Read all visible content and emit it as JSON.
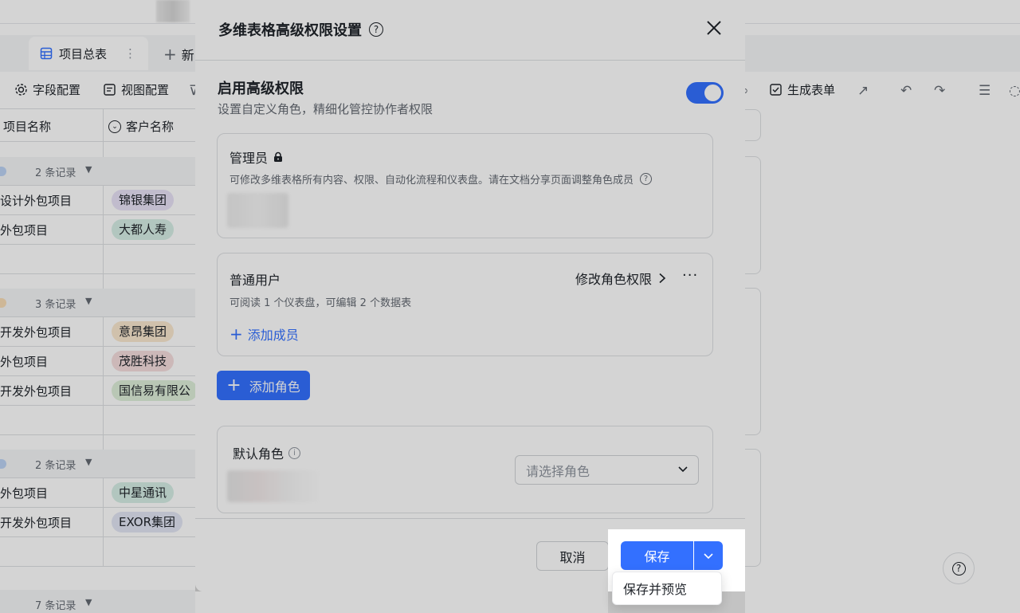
{
  "app": {
    "tab_label": "项目总表",
    "new_tab_label": "新",
    "toolbar": {
      "field_config": "字段配置",
      "view_config": "视图配置",
      "generate_form": "生成表单"
    },
    "grid": {
      "col1_header": "项目名称",
      "col2_header": "客户名称",
      "groups": [
        {
          "count": "2 条记录",
          "rows": [
            {
              "name": "设计外包项目",
              "client": "锦银集团",
              "tag_color": "#e8e2f7"
            },
            {
              "name": "外包项目",
              "client": "大都人寿",
              "tag_color": "#d7efe6"
            }
          ]
        },
        {
          "count": "3 条记录",
          "rows": [
            {
              "name": "开发外包项目",
              "client": "意昂集团",
              "tag_color": "#fbe8cf"
            },
            {
              "name": "外包项目",
              "client": "茂胜科技",
              "tag_color": "#f6dede"
            },
            {
              "name": "开发外包项目",
              "client": "国信易有限公",
              "tag_color": "#dff0da"
            }
          ]
        },
        {
          "count": "2 条记录",
          "rows": [
            {
              "name": "外包项目",
              "client": "中星通讯",
              "tag_color": "#d7efe6"
            },
            {
              "name": "开发外包项目",
              "client": "EXOR集团",
              "tag_color": "#e3e6f5"
            }
          ]
        },
        {
          "count": "7 条记录",
          "rows": []
        }
      ]
    }
  },
  "modal": {
    "title": "多维表格高级权限设置",
    "enable_title": "启用高级权限",
    "enable_subtitle": "设置自定义角色，精细化管控协作者权限",
    "toggle_on": true,
    "admin_card": {
      "title": "管理员",
      "desc": "可修改多维表格所有内容、权限、自动化流程和仪表盘。请在文档分享页面调整角色成员"
    },
    "user_card": {
      "title": "普通用户",
      "edit_perm": "修改角色权限",
      "desc": "可阅读 1 个仪表盘，可编辑 2 个数据表",
      "add_member": "添加成员"
    },
    "add_role": "添加角色",
    "default_role": {
      "title": "默认角色",
      "select_placeholder": "请选择角色"
    },
    "footer": {
      "cancel": "取消",
      "save": "保存",
      "save_preview": "保存并预览"
    }
  },
  "colors": {
    "accent": "#3370ff",
    "text_primary": "#1f2329",
    "text_secondary": "#646a73"
  }
}
